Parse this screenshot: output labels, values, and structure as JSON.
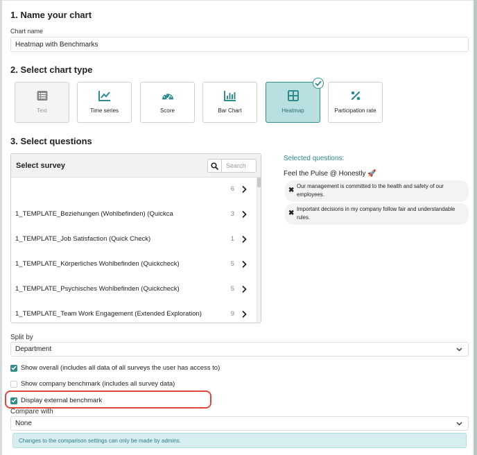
{
  "section1": {
    "title": "1. Name your chart",
    "field_label": "Chart name",
    "chart_name": "Heatmap with Benchmarks"
  },
  "section2": {
    "title": "2. Select chart type",
    "types": [
      {
        "label": "Text",
        "icon": "text-icon",
        "state": "disabled"
      },
      {
        "label": "Time series",
        "icon": "line-chart-icon",
        "state": "default"
      },
      {
        "label": "Score",
        "icon": "gauge-icon",
        "state": "default"
      },
      {
        "label": "Bar Chart",
        "icon": "bar-chart-icon",
        "state": "default"
      },
      {
        "label": "Heatmap",
        "icon": "grid-icon",
        "state": "selected"
      },
      {
        "label": "Participation rate",
        "icon": "percent-icon",
        "state": "default"
      }
    ]
  },
  "section3": {
    "title": "3. Select questions",
    "survey_box_title": "Select survey",
    "search_placeholder": "Search",
    "surveys": [
      {
        "name": "",
        "count": "6"
      },
      {
        "name": "1_TEMPLATE_Beziehungen (Wohlbefinden) (Quickca",
        "count": "3"
      },
      {
        "name": "1_TEMPLATE_Job Satisfaction (Quick Check)",
        "count": "1"
      },
      {
        "name": "1_TEMPLATE_Körperliches Wohlbefinden (Quickcheck)",
        "count": "5"
      },
      {
        "name": "1_TEMPLATE_Psychisches Wohlbefinden (Quickcheck)",
        "count": "5"
      },
      {
        "name": "1_TEMPLATE_Team Work Engagement (Extended Exploration)",
        "count": "9"
      }
    ],
    "selected_title": "Selected questions:",
    "selected_survey": "Feel the Pulse @ Honestly 🚀",
    "selected_questions": [
      "Our management is committed to the health and safety of our employees.",
      "Important decisions in my company follow fair and understandable rules."
    ]
  },
  "split_by": {
    "label": "Split by",
    "value": "Department"
  },
  "options": {
    "show_overall": {
      "label": "Show overall (includes all data of all surveys the user has access to)",
      "checked": true
    },
    "show_company_benchmark": {
      "label": "Show company benchmark (includes all survey data)",
      "checked": false
    },
    "display_external_benchmark": {
      "label": "Display external benchmark",
      "checked": true
    }
  },
  "compare_with": {
    "label": "Compare with",
    "value": "None"
  },
  "info_message": "Changes to the comparison settings can only be made by admins.",
  "colors": {
    "accent": "#2e8c8c",
    "selected_bg": "#b9e0e0",
    "highlight": "#e0443a",
    "info_bg": "#d7eef1"
  }
}
